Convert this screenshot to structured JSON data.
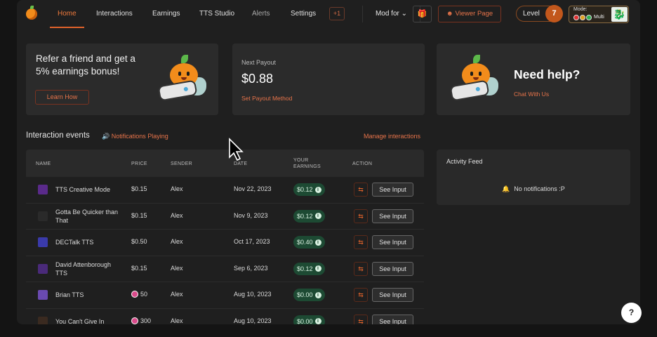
{
  "nav": {
    "tabs": [
      {
        "label": "Home",
        "active": true
      },
      {
        "label": "Interactions",
        "active": false
      },
      {
        "label": "Earnings",
        "active": false
      },
      {
        "label": "TTS Studio",
        "active": false
      },
      {
        "label": "Alerts",
        "active": false
      },
      {
        "label": "Settings",
        "active": false
      }
    ],
    "plus_badge": "+1",
    "mod_for": "Mod for",
    "viewer_page": "Viewer Page",
    "level_label": "Level",
    "level_value": "7",
    "mode_label": "Mode:",
    "mode_value": "Multi"
  },
  "refer_card": {
    "title": "Refer a friend and get a 5% earnings bonus!",
    "button": "Learn How"
  },
  "payout_card": {
    "label": "Next Payout",
    "amount": "$0.88",
    "link": "Set Payout Method"
  },
  "help_card": {
    "title": "Need help?",
    "link": "Chat With Us"
  },
  "interactions": {
    "title": "Interaction events",
    "notifications": "Notifications Playing",
    "manage": "Manage interactions",
    "columns": {
      "name": "NAME",
      "price": "PRICE",
      "sender": "SENDER",
      "date": "DATE",
      "earnings": "YOUR EARNINGS",
      "action": "ACTION"
    },
    "see_input": "See Input",
    "rows": [
      {
        "name": "TTS Creative Mode",
        "price": "$0.15",
        "coin": false,
        "sender": "Alex",
        "date": "Nov 22, 2023",
        "earnings": "$0.12"
      },
      {
        "name": "Gotta Be Quicker than That",
        "price": "$0.15",
        "coin": false,
        "sender": "Alex",
        "date": "Nov 9, 2023",
        "earnings": "$0.12"
      },
      {
        "name": "DECTalk TTS",
        "price": "$0.50",
        "coin": false,
        "sender": "Alex",
        "date": "Oct 17, 2023",
        "earnings": "$0.40"
      },
      {
        "name": "David Attenborough TTS",
        "price": "$0.15",
        "coin": false,
        "sender": "Alex",
        "date": "Sep 6, 2023",
        "earnings": "$0.12"
      },
      {
        "name": "Brian TTS",
        "price": "50",
        "coin": true,
        "sender": "Alex",
        "date": "Aug 10, 2023",
        "earnings": "$0.00"
      },
      {
        "name": "You Can't Give In",
        "price": "300",
        "coin": true,
        "sender": "Alex",
        "date": "Aug 10, 2023",
        "earnings": "$0.00"
      }
    ]
  },
  "activity": {
    "title": "Activity Feed",
    "empty": "No notifications :P"
  },
  "help_fab": "?",
  "colors": {
    "accent": "#e0622b",
    "earn_bg": "#1d4a33",
    "card": "#2b2b2b"
  }
}
